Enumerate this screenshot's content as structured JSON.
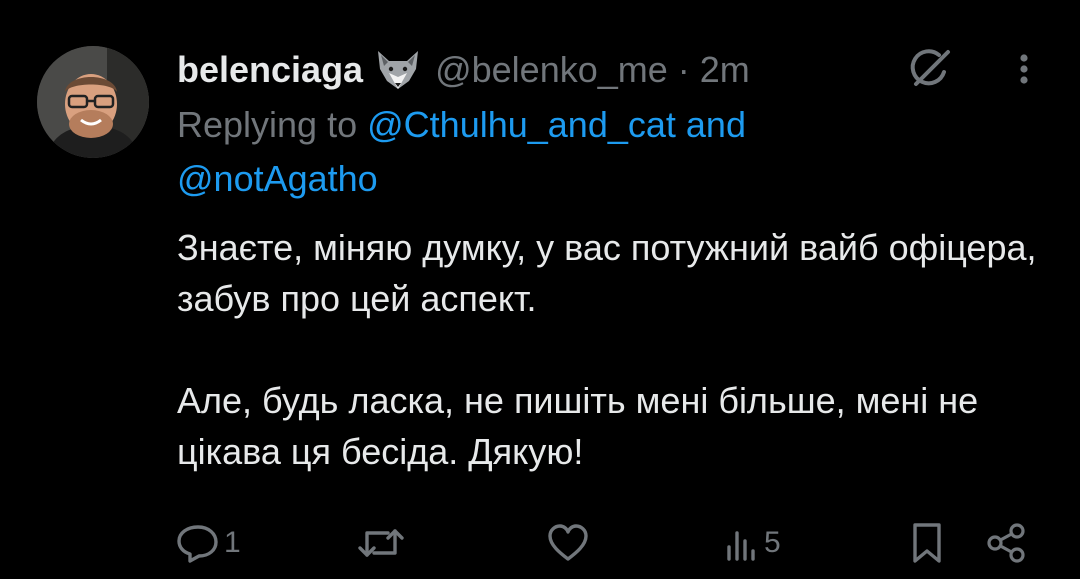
{
  "tweet": {
    "display_name": "belenciaga",
    "badge_icon": "wolf-icon",
    "handle": "@belenko_me",
    "separator": "·",
    "time": "2m",
    "replying_to_label": "Replying to",
    "mention_1": "@Cthulhu_and_cat",
    "mention_joiner": "and",
    "mention_2": "@notAgatho",
    "body_line_1": "Знаєте, міняю думку, у вас потужний вайб офіцера, забув про цей аспект.",
    "body_line_2": "Але, будь ласка, не пишіть мені більше, мені не цікава ця бесіда. Дякую!"
  },
  "actions": {
    "reply_count": "1",
    "views_count": "5"
  },
  "colors": {
    "background": "#000000",
    "text": "#e7e9ea",
    "muted": "#71767b",
    "link": "#1d9bf0"
  }
}
